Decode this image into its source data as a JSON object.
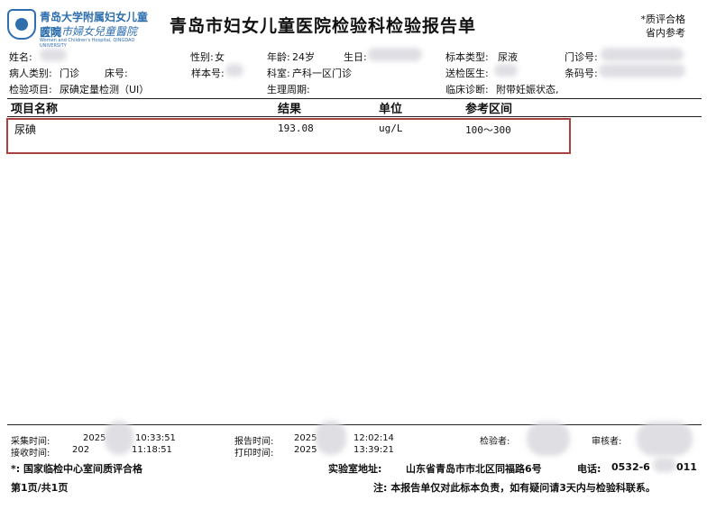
{
  "logo": {
    "name_cn": "青岛大学附属妇女儿童医院",
    "name_cn_script": "青島市婦女兒童醫院",
    "name_en": "Women and Children's Hospital, QINGDAO UNIVERSITY"
  },
  "report": {
    "title": "青岛市妇女儿童医院检验科检验报告单",
    "quality_note_line1": "*质评合格",
    "quality_note_line2": "省内参考"
  },
  "patient": {
    "name_label": "姓名:",
    "gender_label": "性别:",
    "gender_value": "女",
    "age_label": "年龄:",
    "age_value": "24岁",
    "birth_label": "生日:",
    "specimen_type_label": "标本类型:",
    "specimen_type_value": "尿液",
    "outpatient_no_label": "门诊号:",
    "patient_category_label": "病人类别:",
    "patient_category_value": "门诊",
    "bed_no_label": "床号:",
    "sample_no_label": "样本号:",
    "department_label": "科室:",
    "department_value": "产科一区门诊",
    "sending_doctor_label": "送检医生:",
    "barcode_label": "条码号:",
    "test_item_label": "检验项目:",
    "test_item_value": "尿碘定量检测（UI）",
    "cycle_label": "生理周期:",
    "diagnosis_label": "临床诊断:",
    "diagnosis_value": "附带妊娠状态,"
  },
  "table": {
    "columns": [
      "项目名称",
      "结果",
      "单位",
      "参考区间"
    ],
    "rows": [
      {
        "name": "尿碘",
        "result": "193.08",
        "unit": "ug/L",
        "range": "100～300"
      }
    ]
  },
  "footer": {
    "collect_time_label": "采集时间:",
    "collect_time_prefix": "2025",
    "collect_time_suffix": "10:33:51",
    "receive_time_label": "接收时间:",
    "receive_time_prefix": "202",
    "receive_time_suffix": "11:18:51",
    "report_time_label": "报告时间:",
    "report_time_prefix": "2025",
    "report_time_suffix": "12:02:14",
    "print_time_label": "打印时间:",
    "print_time_prefix": "2025",
    "print_time_suffix": "13:39:21",
    "tester_label": "检验者:",
    "reviewer_label": "审核者:",
    "national_note": "*: 国家临检中心室间质评合格",
    "lab_address_label": "实验室地址:",
    "lab_address_value": "山东省青岛市市北区同福路6号",
    "phone_label": "电话:",
    "phone_value": "0532-6",
    "phone_tail": "011",
    "page_info": "第1页/共1页",
    "disclaimer": "注: 本报告单仅对此标本负责，如有疑问请3天内与检验科联系。"
  }
}
